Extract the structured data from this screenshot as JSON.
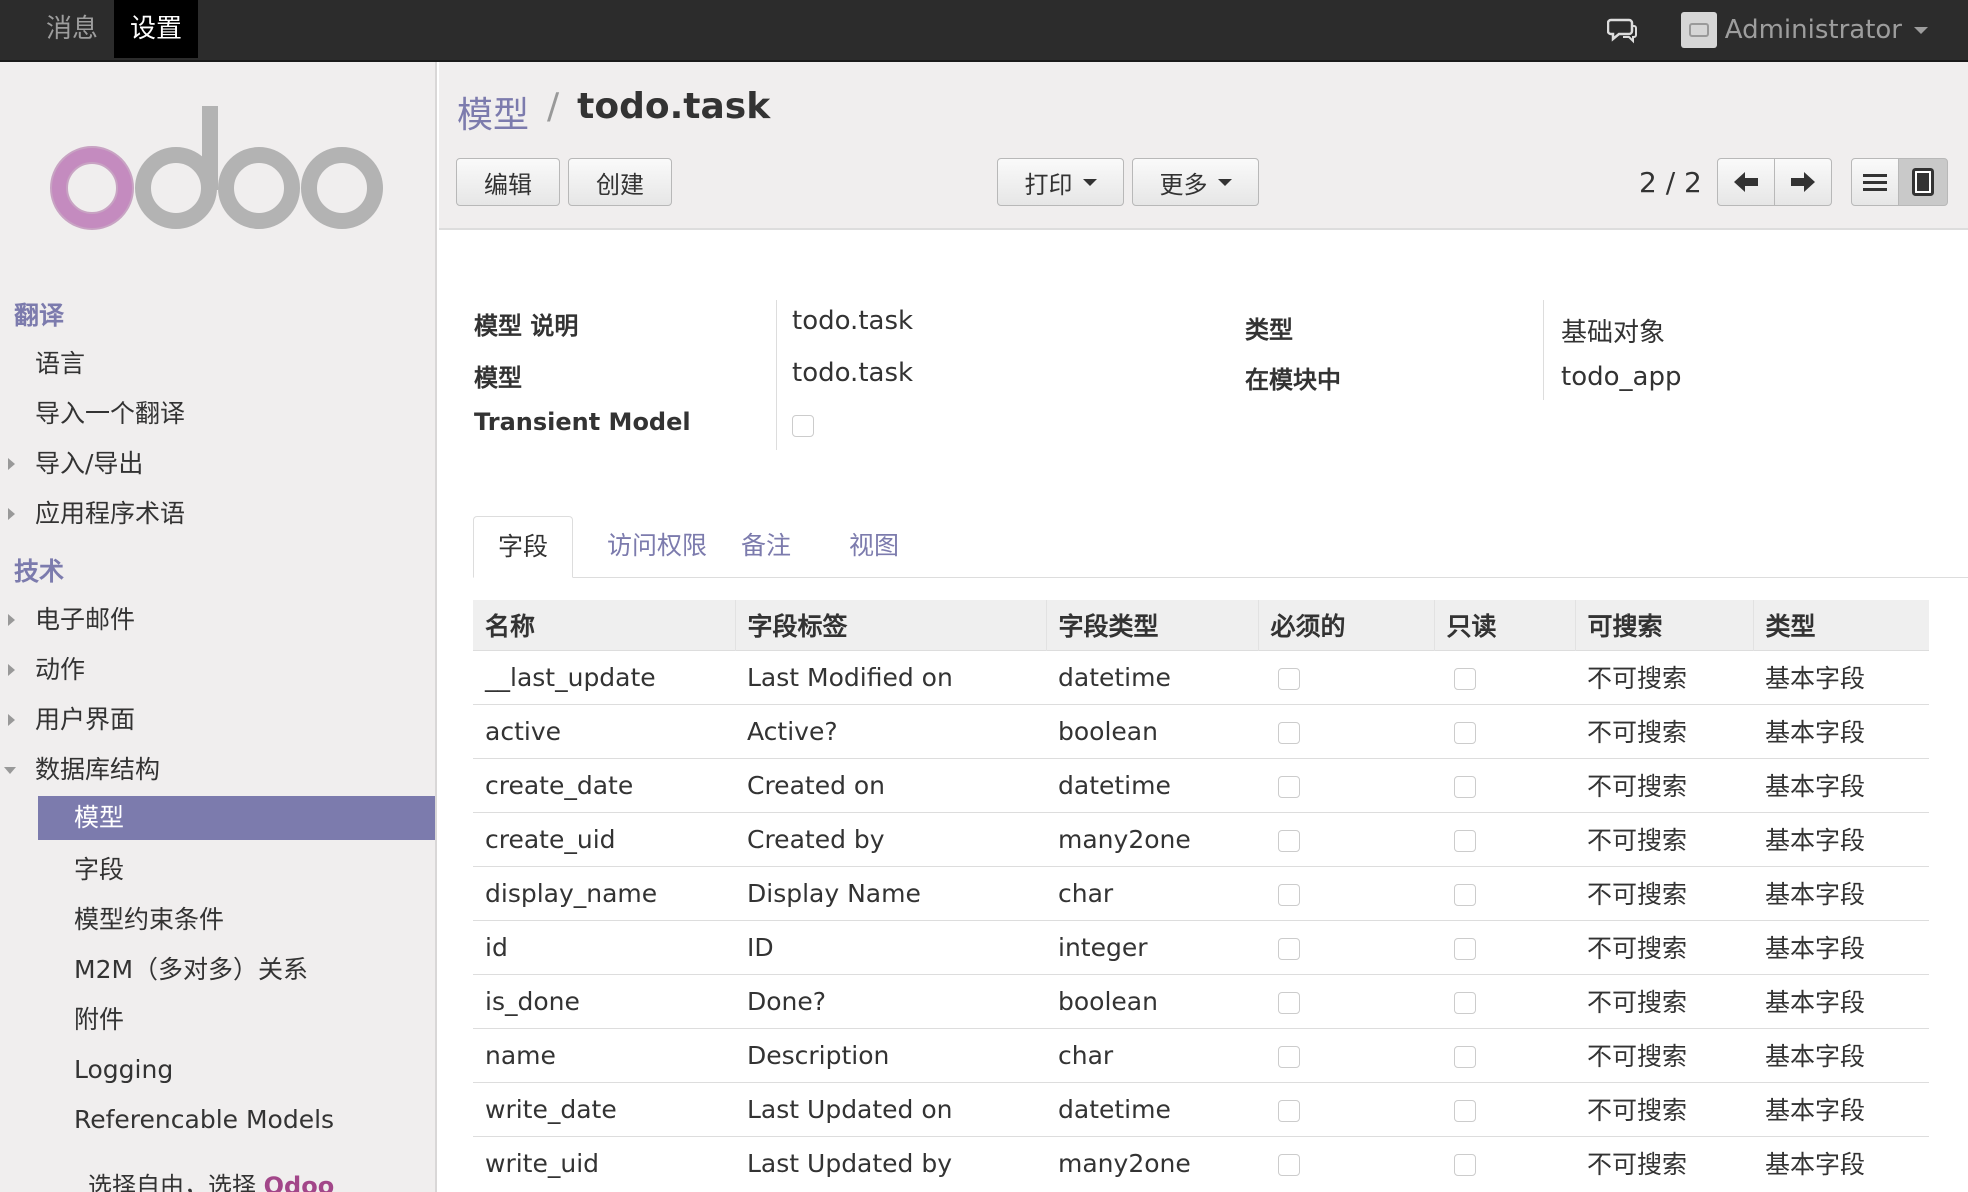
{
  "topbar": {
    "menus": [
      "消息",
      "设置"
    ],
    "active_menu": "设置",
    "user": "Administrator"
  },
  "sidebar": {
    "sections": [
      {
        "title": "翻译",
        "items": [
          {
            "label": "语言",
            "expandable": false
          },
          {
            "label": "导入一个翻译",
            "expandable": false
          },
          {
            "label": "导入/导出",
            "expandable": true
          },
          {
            "label": "应用程序术语",
            "expandable": true
          }
        ]
      },
      {
        "title": "技术",
        "items": [
          {
            "label": "电子邮件",
            "expandable": true
          },
          {
            "label": "动作",
            "expandable": true
          },
          {
            "label": "用户界面",
            "expandable": true
          },
          {
            "label": "数据库结构",
            "expanded": true
          }
        ]
      }
    ],
    "subitems": [
      "模型",
      "字段",
      "模型约束条件",
      "M2M（多对多）关系",
      "附件",
      "Logging",
      "Referencable Models"
    ],
    "active_subitem": "模型",
    "footer_prefix": "选择自由，选择",
    "footer_brand": "Odoo"
  },
  "breadcrumb": {
    "parent": "模型",
    "separator": "/",
    "current": "todo.task"
  },
  "toolbar": {
    "edit": "编辑",
    "create": "创建",
    "print": "打印",
    "more": "更多",
    "pager": "2 / 2"
  },
  "form": {
    "labels": {
      "description": "模型 说明",
      "model": "模型",
      "transient": "Transient Model",
      "type": "类型",
      "in_modules": "在模块中"
    },
    "values": {
      "description": "todo.task",
      "model": "todo.task",
      "type": "基础对象",
      "in_modules": "todo_app"
    }
  },
  "tabs": [
    "字段",
    "访问权限",
    "备注",
    "视图"
  ],
  "active_tab": "字段",
  "fields_table": {
    "columns": [
      "名称",
      "字段标签",
      "字段类型",
      "必须的",
      "只读",
      "可搜索",
      "类型"
    ],
    "rows": [
      {
        "name": "__last_update",
        "label": "Last Modified on",
        "ftype": "datetime",
        "searchable": "不可搜索",
        "kind": "基本字段"
      },
      {
        "name": "active",
        "label": "Active?",
        "ftype": "boolean",
        "searchable": "不可搜索",
        "kind": "基本字段"
      },
      {
        "name": "create_date",
        "label": "Created on",
        "ftype": "datetime",
        "searchable": "不可搜索",
        "kind": "基本字段"
      },
      {
        "name": "create_uid",
        "label": "Created by",
        "ftype": "many2one",
        "searchable": "不可搜索",
        "kind": "基本字段"
      },
      {
        "name": "display_name",
        "label": "Display Name",
        "ftype": "char",
        "searchable": "不可搜索",
        "kind": "基本字段"
      },
      {
        "name": "id",
        "label": "ID",
        "ftype": "integer",
        "searchable": "不可搜索",
        "kind": "基本字段"
      },
      {
        "name": "is_done",
        "label": "Done?",
        "ftype": "boolean",
        "searchable": "不可搜索",
        "kind": "基本字段"
      },
      {
        "name": "name",
        "label": "Description",
        "ftype": "char",
        "searchable": "不可搜索",
        "kind": "基本字段"
      },
      {
        "name": "write_date",
        "label": "Last Updated on",
        "ftype": "datetime",
        "searchable": "不可搜索",
        "kind": "基本字段"
      },
      {
        "name": "write_uid",
        "label": "Last Updated by",
        "ftype": "many2one",
        "searchable": "不可搜索",
        "kind": "基本字段"
      }
    ]
  },
  "colors": {
    "accent": "#7c7bad",
    "brand": "#a24689",
    "topbar": "#2c2c2c"
  }
}
